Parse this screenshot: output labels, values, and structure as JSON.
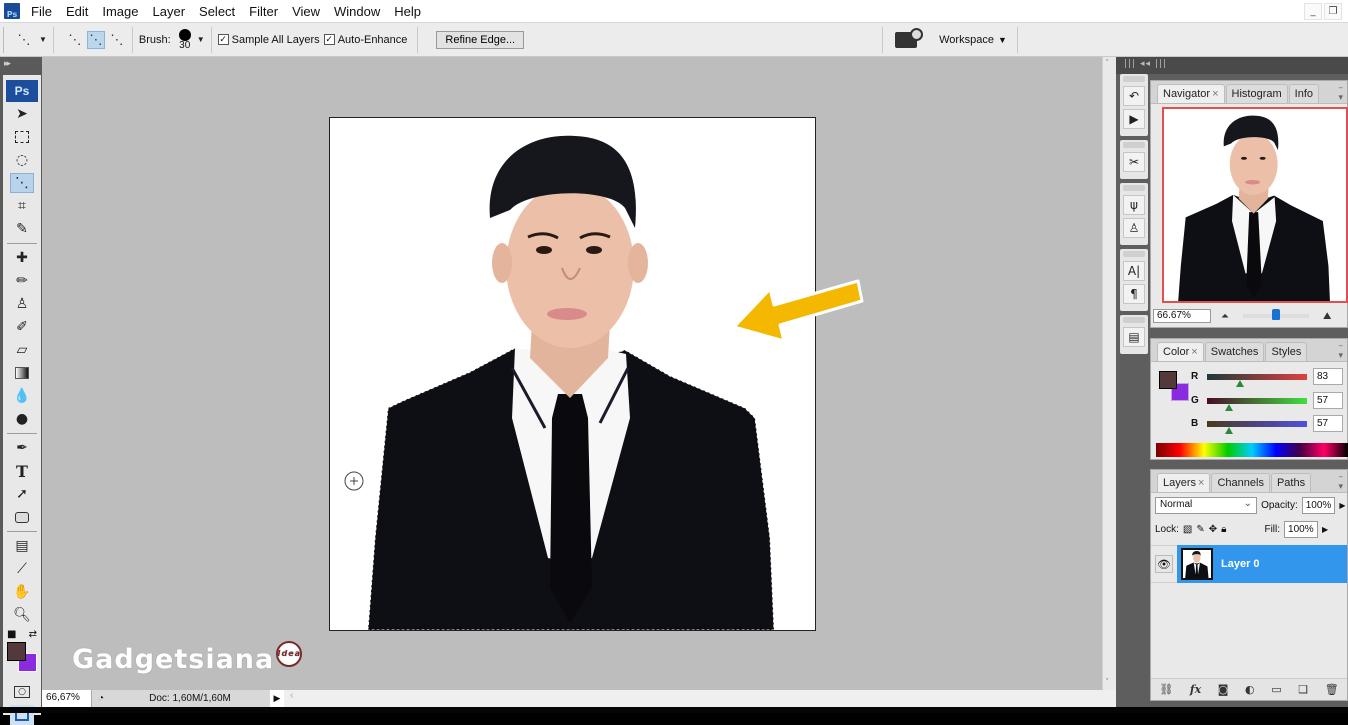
{
  "app": {
    "name": "Ps"
  },
  "menubar": {
    "items": [
      "File",
      "Edit",
      "Image",
      "Layer",
      "Select",
      "Filter",
      "View",
      "Window",
      "Help"
    ],
    "window_buttons": [
      "minimize",
      "restore"
    ]
  },
  "options_bar": {
    "brush_label": "Brush:",
    "brush_size": "30",
    "sample_all_layers": {
      "label": "Sample All Layers",
      "checked": true
    },
    "auto_enhance": {
      "label": "Auto-Enhance",
      "checked": true
    },
    "refine_edge_label": "Refine Edge...",
    "workspace_label": "Workspace"
  },
  "tools": {
    "active": "quick-selection-tool",
    "foreground_color": "#533939",
    "background_color": "#8a2be2"
  },
  "document": {
    "zoom": "66,67%",
    "doc_info": "Doc: 1,60M/1,60M"
  },
  "watermark": {
    "text": "Gadgetsiana",
    "badge": "Idea"
  },
  "navigator": {
    "tabs": [
      {
        "label": "Navigator",
        "closable": true
      },
      {
        "label": "Histogram"
      },
      {
        "label": "Info"
      }
    ],
    "zoom": "66.67%",
    "zoom_slider_fraction": 0.5
  },
  "color_panel": {
    "tabs": [
      {
        "label": "Color",
        "closable": true
      },
      {
        "label": "Swatches"
      },
      {
        "label": "Styles"
      }
    ],
    "channels": [
      {
        "label": "R",
        "value": "83",
        "fraction": 0.33
      },
      {
        "label": "G",
        "value": "57",
        "fraction": 0.22
      },
      {
        "label": "B",
        "value": "57",
        "fraction": 0.22
      }
    ]
  },
  "layers_panel": {
    "tabs": [
      {
        "label": "Layers",
        "closable": true
      },
      {
        "label": "Channels"
      },
      {
        "label": "Paths"
      }
    ],
    "blend_mode": "Normal",
    "opacity_label": "Opacity:",
    "opacity": "100%",
    "lock_label": "Lock:",
    "fill_label": "Fill:",
    "fill": "100%",
    "layers": [
      {
        "name": "Layer 0",
        "visible": true,
        "selected": true
      }
    ]
  }
}
